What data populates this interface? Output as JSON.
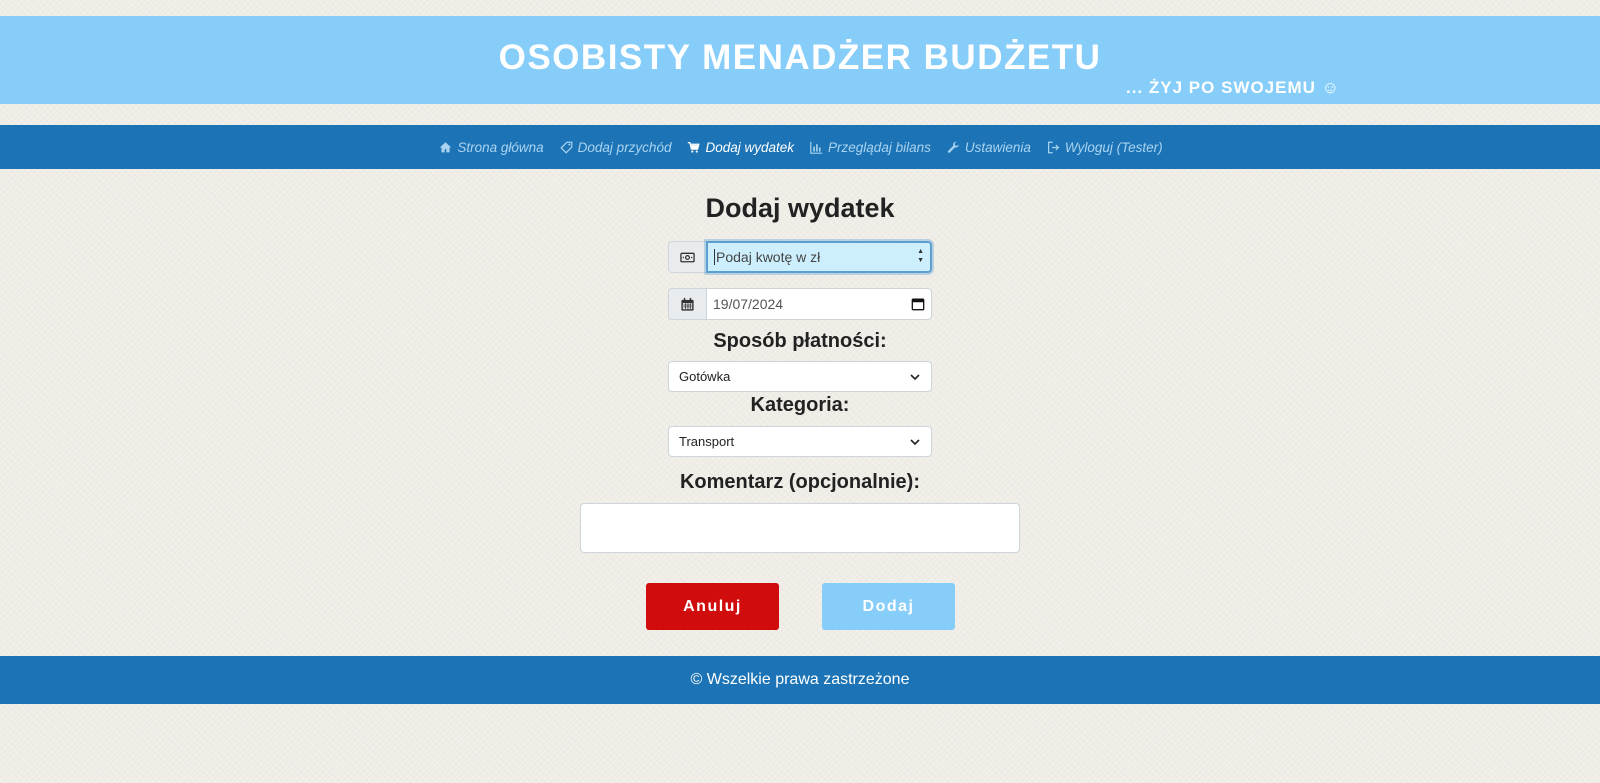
{
  "banner": {
    "title": "OSOBISTY MENADŻER BUDŻETU",
    "tagline": "... ŻYJ PO SWOJEMU ☺"
  },
  "nav": {
    "items": [
      {
        "label": "Strona główna",
        "icon": "home-icon"
      },
      {
        "label": "Dodaj przychód",
        "icon": "tag-icon"
      },
      {
        "label": "Dodaj wydatek",
        "icon": "cart-icon",
        "active": true
      },
      {
        "label": "Przeglądaj bilans",
        "icon": "bar-chart-icon"
      },
      {
        "label": "Ustawienia",
        "icon": "wrench-icon"
      },
      {
        "label": "Wyloguj (Tester)",
        "icon": "logout-icon"
      }
    ]
  },
  "form": {
    "title": "Dodaj wydatek",
    "amount": {
      "placeholder": "Podaj kwotę w zł",
      "value": "",
      "icon": "money-icon"
    },
    "date": {
      "value": "19/07/2024",
      "icon": "calendar-icon"
    },
    "payment_label": "Sposób płatności:",
    "payment_selected": "Gotówka",
    "category_label": "Kategoria:",
    "category_selected": "Transport",
    "comment_label": "Komentarz (opcjonalnie):",
    "comment_value": "",
    "cancel_label": "Anuluj",
    "submit_label": "Dodaj"
  },
  "footer": {
    "text": "© Wszelkie prawa zastrzeżone"
  },
  "colors": {
    "banner": "#87cdf9",
    "nav": "#1c74b6",
    "cancel": "#d10c0c",
    "submit": "#87cdf9"
  }
}
